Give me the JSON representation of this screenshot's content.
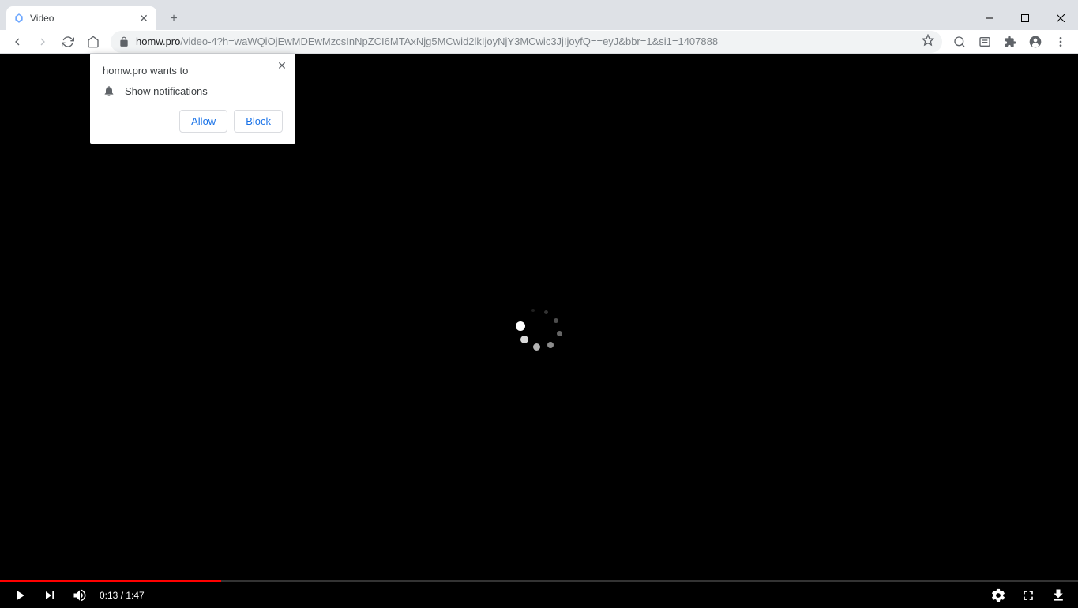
{
  "tab": {
    "title": "Video"
  },
  "omnibox": {
    "domain": "homw.pro",
    "path": "/video-4?h=waWQiOjEwMDEwMzcsInNpZCI6MTAxNjg5MCwid2lkIjoyNjY3MCwic3JjIjoyfQ==eyJ&bbr=1&si1=1407888"
  },
  "notification": {
    "title": "homw.pro wants to",
    "permission": "Show notifications",
    "allow": "Allow",
    "block": "Block"
  },
  "video": {
    "current_time": "0:13",
    "duration": "1:47"
  }
}
